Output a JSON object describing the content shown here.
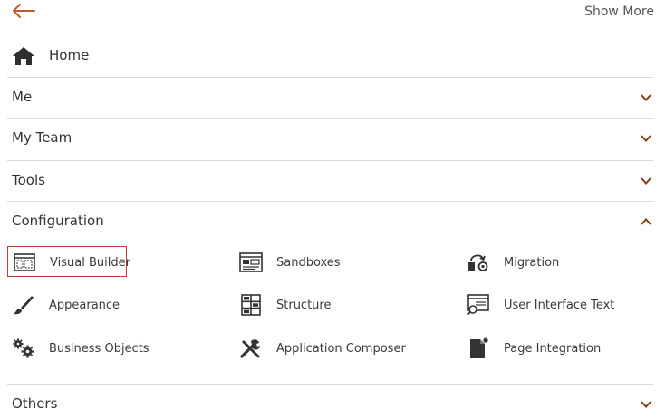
{
  "header": {
    "back_icon": "back-arrow-icon",
    "show_more_label": "Show More"
  },
  "home": {
    "label": "Home",
    "icon": "home-icon"
  },
  "sections": [
    {
      "label": "Me",
      "expanded": false
    },
    {
      "label": "My Team",
      "expanded": false
    },
    {
      "label": "Tools",
      "expanded": false
    },
    {
      "label": "Configuration",
      "expanded": true
    },
    {
      "label": "Others",
      "expanded": false
    }
  ],
  "configuration_items": [
    {
      "label": "Visual Builder",
      "icon": "visual-builder-icon",
      "selected": true
    },
    {
      "label": "Sandboxes",
      "icon": "sandboxes-icon",
      "selected": false
    },
    {
      "label": "Migration",
      "icon": "migration-icon",
      "selected": false
    },
    {
      "label": "Appearance",
      "icon": "brush-icon",
      "selected": false
    },
    {
      "label": "Structure",
      "icon": "structure-grid-icon",
      "selected": false
    },
    {
      "label": "User Interface Text",
      "icon": "user-interface-text-icon",
      "selected": false
    },
    {
      "label": "Business Objects",
      "icon": "gears-icon",
      "selected": false
    },
    {
      "label": "Application Composer",
      "icon": "tools-icon",
      "selected": false
    },
    {
      "label": "Page Integration",
      "icon": "page-integration-icon",
      "selected": false
    }
  ],
  "colors": {
    "accent": "#c05a2c",
    "selection_border": "#c23a3a",
    "text": "#333333",
    "divider": "#dcdcdc"
  }
}
